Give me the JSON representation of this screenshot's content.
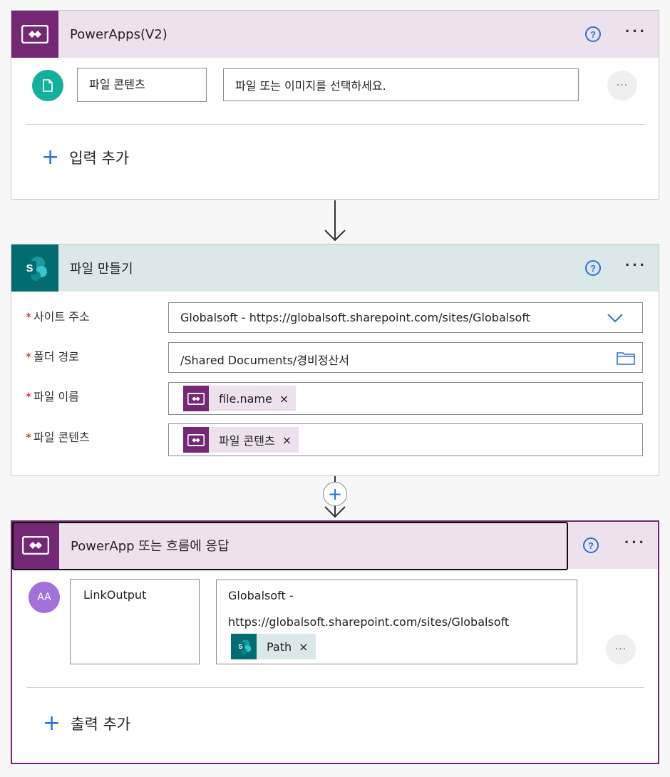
{
  "card1": {
    "title": "PowerApps(V2)",
    "input_name": "파일 콘텐츠",
    "input_placeholder": "파일 또는 이미지를 선택하세요.",
    "add_input": "입력 추가"
  },
  "card2": {
    "title": "파일 만들기",
    "fields": [
      {
        "label": "사이트 주소",
        "value": "Globalsoft - https://globalsoft.sharepoint.com/sites/Globalsoft"
      },
      {
        "label": "폴더 경로",
        "value": "/Shared Documents/경비정산서"
      },
      {
        "label": "파일 이름",
        "token": "file.name"
      },
      {
        "label": "파일 콘텐츠",
        "token": "파일 콘텐츠"
      }
    ]
  },
  "card3": {
    "title": "PowerApp 또는 흐름에 응답",
    "avatar": "AA",
    "output_name": "LinkOutput",
    "output_value_line1": "Globalsoft -",
    "output_value_line2": "https://globalsoft.sharepoint.com/sites/Globalsoft",
    "output_token": "Path",
    "add_output": "출력 추가"
  },
  "common": {
    "help_glyph": "?",
    "more_glyph": "···",
    "close_glyph": "×",
    "required_mark": "*",
    "plus_glyph": "+"
  },
  "colors": {
    "powerapps_purple": "#742774",
    "powerapps_header_bg": "#ede1ee",
    "sharepoint_teal": "#036c70",
    "sharepoint_header_bg": "#dbe8e9",
    "accent_blue": "#2d6fd6",
    "required_red": "#c00000"
  }
}
